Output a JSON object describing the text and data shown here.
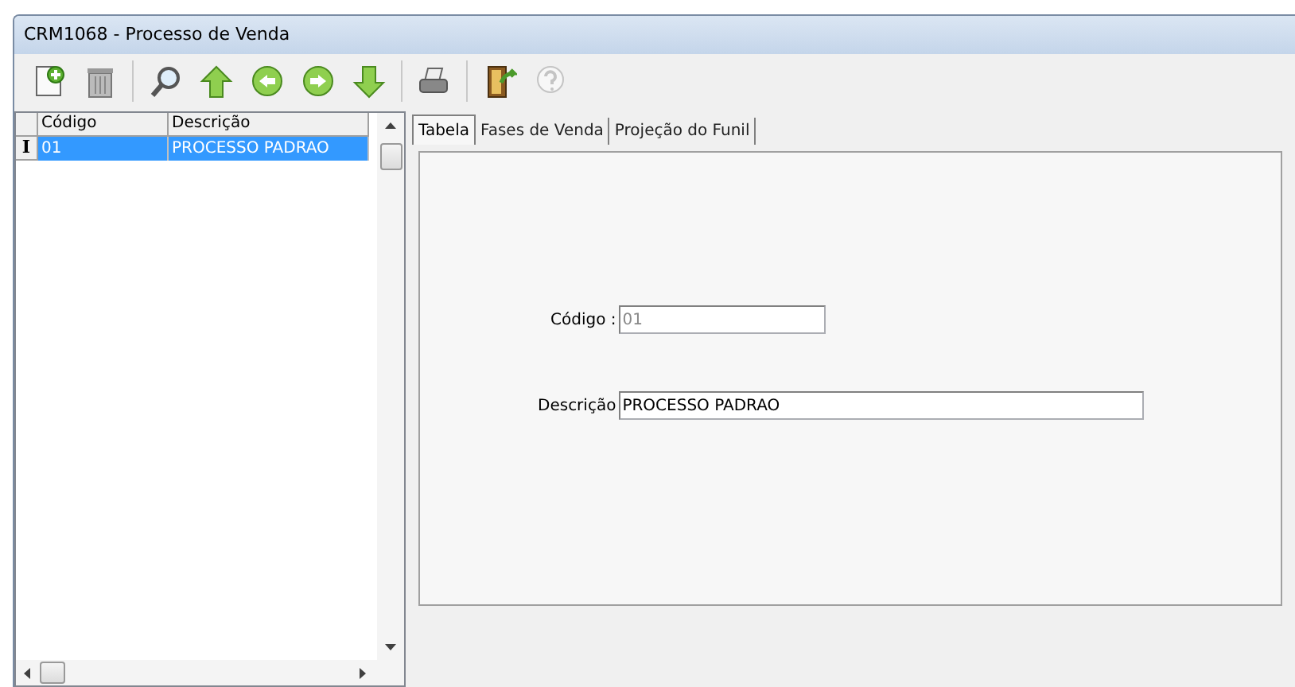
{
  "window": {
    "title": "CRM1068 - Processo de Venda"
  },
  "toolbar": [
    {
      "kind": "new",
      "disabled": false
    },
    {
      "kind": "delete",
      "disabled": false
    },
    {
      "kind": "sep"
    },
    {
      "kind": "search",
      "disabled": false
    },
    {
      "kind": "up",
      "disabled": false
    },
    {
      "kind": "left",
      "disabled": false
    },
    {
      "kind": "right",
      "disabled": false
    },
    {
      "kind": "down",
      "disabled": false
    },
    {
      "kind": "sep"
    },
    {
      "kind": "print",
      "disabled": false
    },
    {
      "kind": "sep"
    },
    {
      "kind": "exit",
      "disabled": false
    },
    {
      "kind": "help",
      "disabled": true
    }
  ],
  "grid": {
    "columns": [
      "Código",
      "Descrição"
    ],
    "rows": [
      {
        "cells": [
          "01",
          "PROCESSO PADRAO"
        ],
        "selected": true,
        "indicator": "I"
      }
    ]
  },
  "tabs": [
    {
      "label": "Tabela",
      "selected": true
    },
    {
      "label": "Fases de Venda",
      "selected": false
    },
    {
      "label": "Projeção do Funil",
      "selected": false
    }
  ],
  "form": {
    "fields": [
      {
        "label": "Código :",
        "value": "01",
        "disabled": true
      },
      {
        "label": "Descrição",
        "value": "PROCESSO PADRAO",
        "disabled": false
      }
    ]
  }
}
